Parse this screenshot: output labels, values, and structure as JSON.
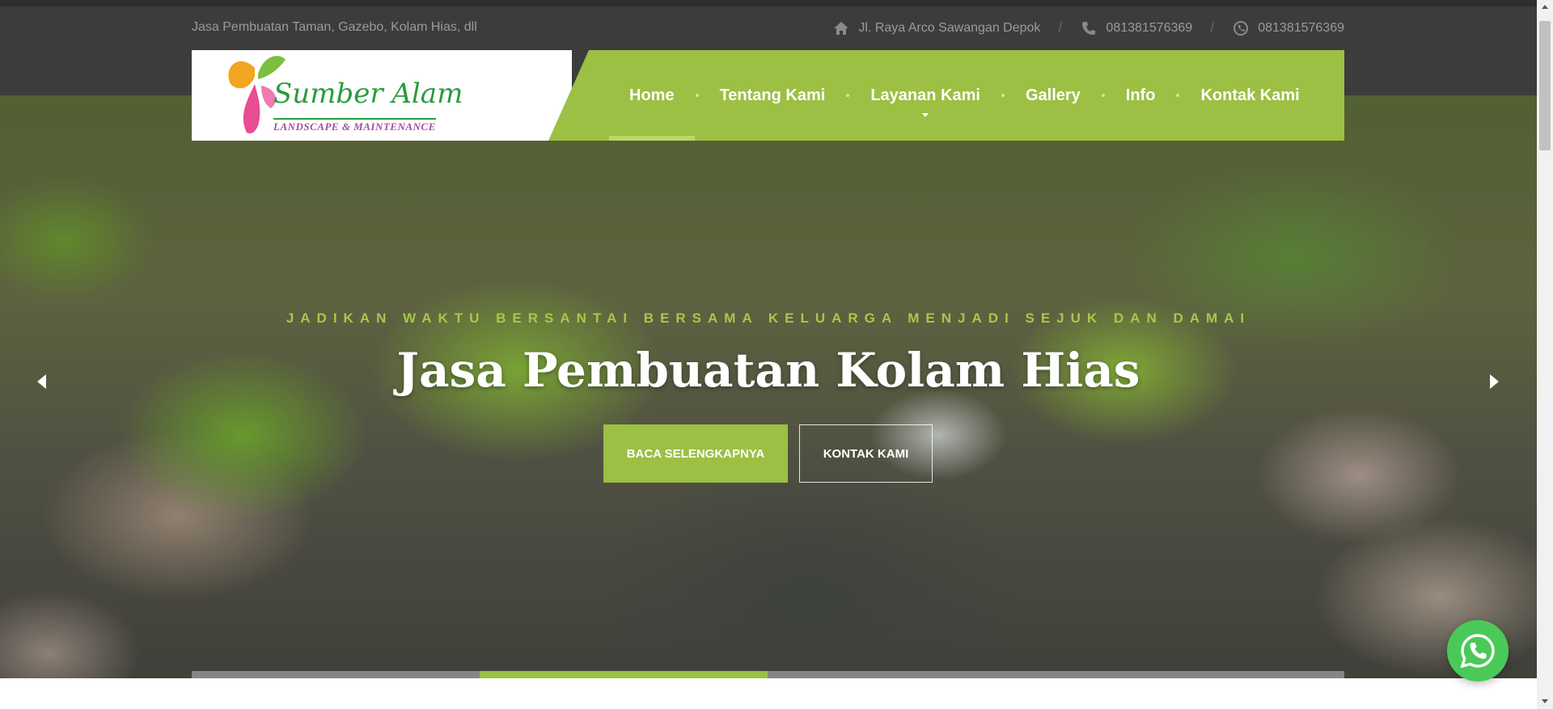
{
  "topbar": {
    "tagline": "Jasa Pembuatan Taman, Gazebo, Kolam Hias, dll",
    "address": "Jl. Raya Arco Sawangan Depok",
    "phone": "081381576369",
    "whatsapp": "081381576369",
    "address_icon": "home-icon",
    "phone_icon": "phone-icon",
    "whatsapp_icon": "whatsapp-icon"
  },
  "logo": {
    "title": "Sumber Alam",
    "subtitle": "LANDSCAPE & MAINTENANCE"
  },
  "nav": {
    "items": [
      {
        "label": "Home",
        "active": true
      },
      {
        "label": "Tentang Kami"
      },
      {
        "label": "Layanan Kami",
        "has_dropdown": true
      },
      {
        "label": "Gallery"
      },
      {
        "label": "Info"
      },
      {
        "label": "Kontak Kami"
      }
    ]
  },
  "hero": {
    "kicker": "JADIKAN WAKTU BERSANTAI BERSAMA KELUARGA MENJADI SEJUK DAN DAMAI",
    "title": "Jasa Pembuatan Kolam Hias",
    "primary_button": "BACA SELENGKAPNYA",
    "secondary_button": "KONTAK KAMI",
    "slide_progress": 0.25
  },
  "colors": {
    "accent": "#9bc043",
    "topbar": "#3c3c3c",
    "whatsapp": "#4ac959"
  }
}
